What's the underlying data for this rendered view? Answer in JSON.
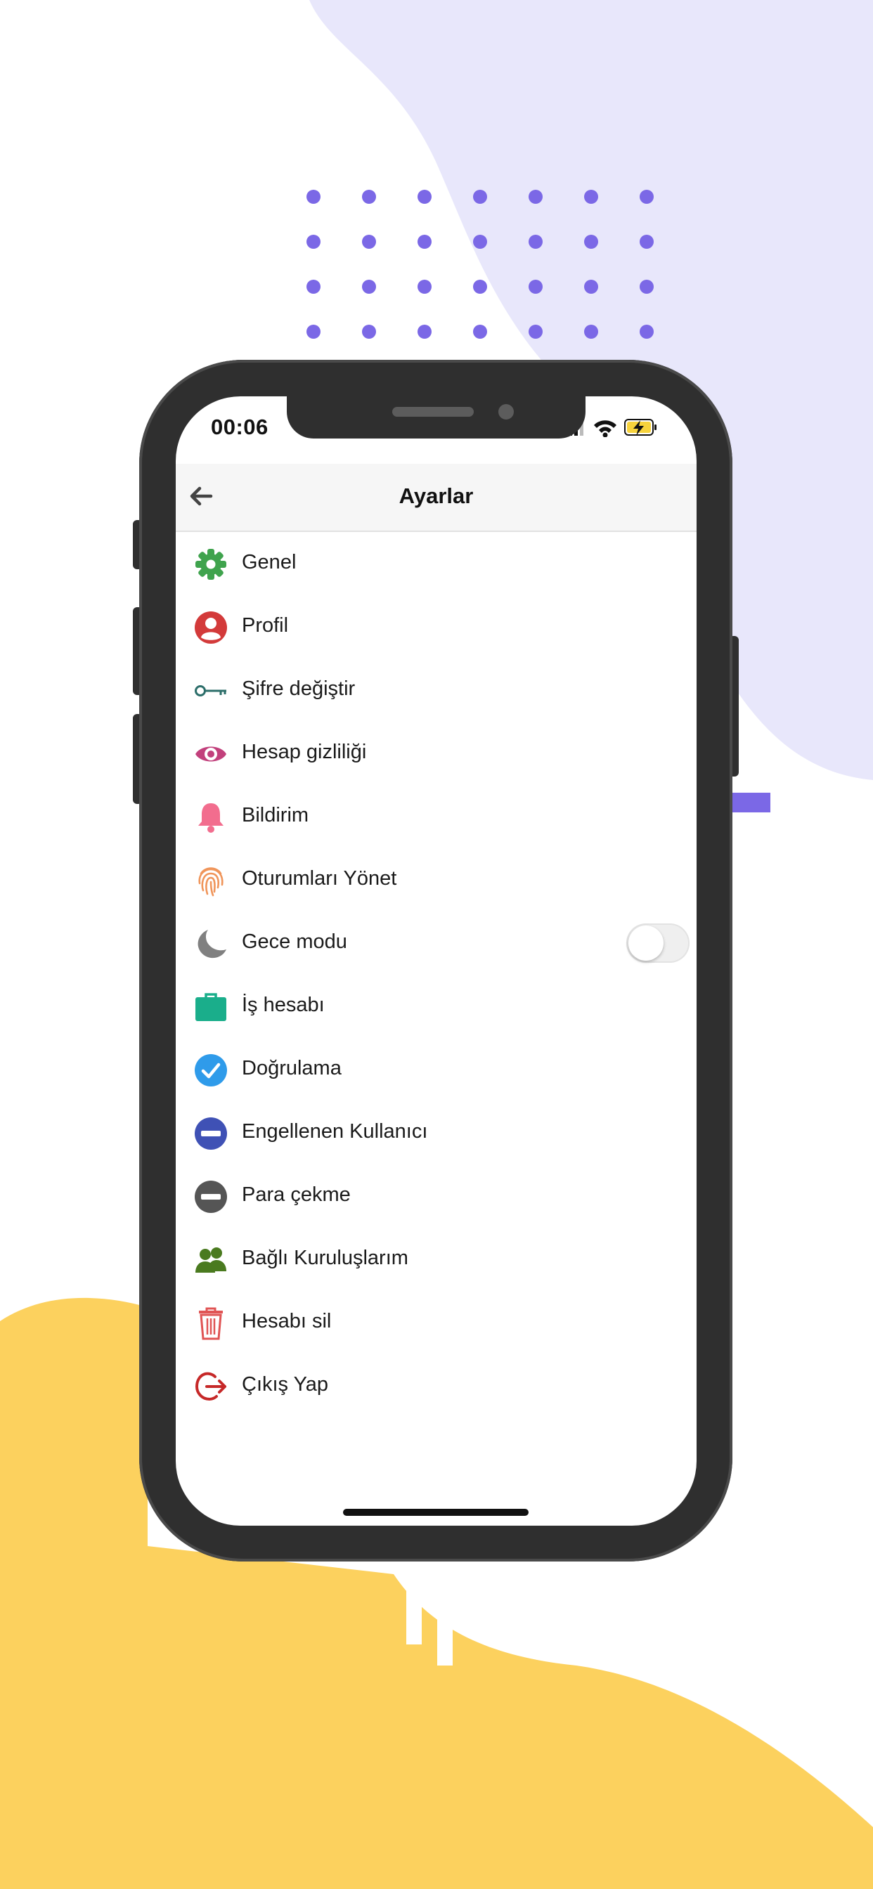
{
  "colors": {
    "lavender": "#E8E7FB",
    "yellow": "#FCD15E",
    "dot_purple": "#7B68E6",
    "phone_body": "#2f2f2f"
  },
  "status_bar": {
    "time": "00:06",
    "icons": [
      "signal-icon",
      "wifi-icon",
      "battery-charging-icon"
    ]
  },
  "header": {
    "title": "Ayarlar",
    "back_icon": "arrow-left-icon"
  },
  "menu": [
    {
      "label": "Genel",
      "icon": "gear-icon",
      "color": "#3FA34D"
    },
    {
      "label": "Profil",
      "icon": "user-circle-icon",
      "color": "#D33A3A"
    },
    {
      "label": "Şifre değiştir",
      "icon": "key-icon",
      "color": "#2C6E6A"
    },
    {
      "label": "Hesap gizliliği",
      "icon": "eye-icon",
      "color": "#C2407C"
    },
    {
      "label": "Bildirim",
      "icon": "bell-icon",
      "color": "#F26D8E"
    },
    {
      "label": "Oturumları Yönet",
      "icon": "fingerprint-icon",
      "color": "#F0955A"
    },
    {
      "label": "Gece modu",
      "icon": "moon-icon",
      "color": "#808080",
      "toggle_on": false
    },
    {
      "label": "İş hesabı",
      "icon": "briefcase-icon",
      "color": "#1AAE8B"
    },
    {
      "label": "Doğrulama",
      "icon": "check-circle-icon",
      "color": "#2F9BEA"
    },
    {
      "label": "Engellenen Kullanıcı",
      "icon": "block-icon",
      "color": "#3F51B5"
    },
    {
      "label": "Para çekme",
      "icon": "minus-circle-icon",
      "color": "#555555"
    },
    {
      "label": "Bağlı Kuruluşlarım",
      "icon": "users-icon",
      "color": "#4A7A1F"
    },
    {
      "label": "Hesabı sil",
      "icon": "trash-icon",
      "color": "#E05454"
    },
    {
      "label": "Çıkış Yap",
      "icon": "logout-icon",
      "color": "#C62828"
    }
  ]
}
